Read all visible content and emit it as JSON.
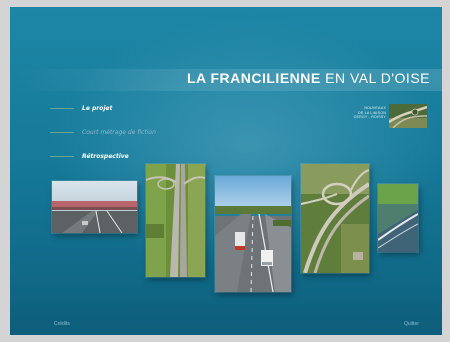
{
  "header": {
    "title_bold": "LA FRANCILIENNE",
    "title_light": " EN VAL D'OISE"
  },
  "menu": {
    "items": [
      {
        "label": "Le projet"
      },
      {
        "label": "Court métrage de fiction"
      },
      {
        "label": "Rétrospective"
      }
    ]
  },
  "logo": {
    "lines": [
      "Nouveaux",
      "de la liaison",
      "Cergy - Roissy"
    ]
  },
  "photos": [
    {
      "icon": "highway-tollgate-photo"
    },
    {
      "icon": "highway-aerial-vertical-photo"
    },
    {
      "icon": "highway-trucks-photo"
    },
    {
      "icon": "highway-interchange-aerial-photo"
    },
    {
      "icon": "highway-curve-photo"
    }
  ],
  "footer": {
    "credits": "Crédits",
    "quit": "Quitter"
  },
  "colors": {
    "background": "#167a9a",
    "frame": "#d4d4d4",
    "menu_dash": "#6fa28a"
  }
}
